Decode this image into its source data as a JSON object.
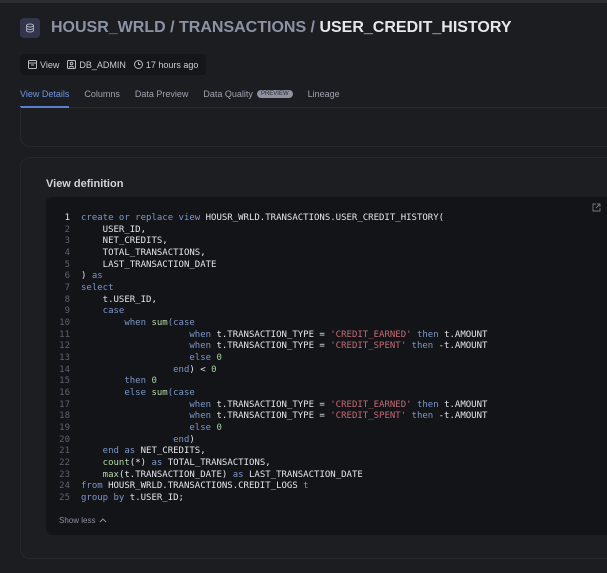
{
  "header": {
    "path_prefix": "HOUSR_WRLD / TRANSACTIONS / ",
    "current": "USER_CREDIT_HISTORY",
    "icon": "database-icon"
  },
  "meta": {
    "type": "View",
    "owner": "DB_ADMIN",
    "updated": "17 hours ago"
  },
  "tabs": [
    {
      "label": "View Details",
      "active": true
    },
    {
      "label": "Columns"
    },
    {
      "label": "Data Preview"
    },
    {
      "label": "Data Quality",
      "badge": "PREVIEW"
    },
    {
      "label": "Lineage"
    }
  ],
  "view_definition": {
    "title": "View definition",
    "show_less": "Show less",
    "colors": {
      "keyword": "#7c97c9",
      "string": "#c56b75",
      "number": "#9fd39a"
    },
    "lines": [
      [
        [
          "k",
          "create or replace view "
        ],
        [
          "p",
          "HOUSR_WRLD.TRANSACTIONS.USER_CREDIT_HISTORY("
        ]
      ],
      [
        [
          "p",
          "    USER_ID,"
        ]
      ],
      [
        [
          "p",
          "    NET_CREDITS,"
        ]
      ],
      [
        [
          "p",
          "    TOTAL_TRANSACTIONS,"
        ]
      ],
      [
        [
          "p",
          "    LAST_TRANSACTION_DATE"
        ]
      ],
      [
        [
          "p",
          ") "
        ],
        [
          "k",
          "as"
        ]
      ],
      [
        [
          "k",
          "select"
        ]
      ],
      [
        [
          "p",
          "    t.USER_ID,"
        ]
      ],
      [
        [
          "k",
          "    case"
        ]
      ],
      [
        [
          "k",
          "        when "
        ],
        [
          "f",
          "sum"
        ],
        [
          "k",
          "(case"
        ]
      ],
      [
        [
          "k",
          "                    when "
        ],
        [
          "p",
          "t.TRANSACTION_TYPE = "
        ],
        [
          "s",
          "'CREDIT_EARNED'"
        ],
        [
          "k",
          " then "
        ],
        [
          "p",
          "t.AMOUNT"
        ]
      ],
      [
        [
          "k",
          "                    when "
        ],
        [
          "p",
          "t.TRANSACTION_TYPE = "
        ],
        [
          "s",
          "'CREDIT_SPENT'"
        ],
        [
          "k",
          " then "
        ],
        [
          "p",
          "-t.AMOUNT"
        ]
      ],
      [
        [
          "k",
          "                    else "
        ],
        [
          "n",
          "0"
        ]
      ],
      [
        [
          "k",
          "                 end"
        ],
        [
          "p",
          ") < "
        ],
        [
          "n",
          "0"
        ]
      ],
      [
        [
          "k",
          "        then "
        ],
        [
          "n",
          "0"
        ]
      ],
      [
        [
          "k",
          "        else "
        ],
        [
          "f",
          "sum"
        ],
        [
          "k",
          "(case"
        ]
      ],
      [
        [
          "k",
          "                    when "
        ],
        [
          "p",
          "t.TRANSACTION_TYPE = "
        ],
        [
          "s",
          "'CREDIT_EARNED'"
        ],
        [
          "k",
          " then "
        ],
        [
          "p",
          "t.AMOUNT"
        ]
      ],
      [
        [
          "k",
          "                    when "
        ],
        [
          "p",
          "t.TRANSACTION_TYPE = "
        ],
        [
          "s",
          "'CREDIT_SPENT'"
        ],
        [
          "k",
          " then "
        ],
        [
          "p",
          "-t.AMOUNT"
        ]
      ],
      [
        [
          "k",
          "                    else "
        ],
        [
          "n",
          "0"
        ]
      ],
      [
        [
          "k",
          "                 end"
        ],
        [
          "p",
          ")"
        ]
      ],
      [
        [
          "k",
          "    end as "
        ],
        [
          "p",
          "NET_CREDITS,"
        ]
      ],
      [
        [
          "f",
          "    count"
        ],
        [
          "p",
          "(*) "
        ],
        [
          "k",
          "as "
        ],
        [
          "p",
          "TOTAL_TRANSACTIONS,"
        ]
      ],
      [
        [
          "f",
          "    max"
        ],
        [
          "p",
          "(t.TRANSACTION_DATE) "
        ],
        [
          "k",
          "as "
        ],
        [
          "p",
          "LAST_TRANSACTION_DATE"
        ]
      ],
      [
        [
          "k",
          "from "
        ],
        [
          "p",
          "HOUSR_WRLD.TRANSACTIONS.CREDIT_LOGS "
        ],
        [
          "k",
          "t"
        ]
      ],
      [
        [
          "k",
          "group by "
        ],
        [
          "p",
          "t.USER_ID;"
        ]
      ]
    ]
  }
}
